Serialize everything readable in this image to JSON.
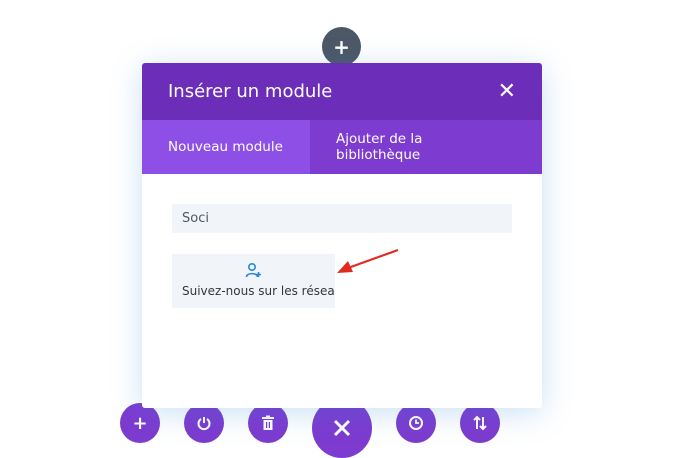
{
  "modal": {
    "title": "Insérer un module",
    "close_icon": "close-icon",
    "tabs": [
      {
        "label": "Nouveau module",
        "active": true
      },
      {
        "label_line1": "Ajouter de la",
        "label_line2": "bibliothèque",
        "active": false
      }
    ],
    "search": {
      "value": "Soci",
      "placeholder": ""
    },
    "modules": [
      {
        "label": "Suivez-nous sur les réseaux sociaux",
        "icon": "follow-user-icon"
      }
    ]
  },
  "bottom_toolbar": [
    {
      "icon": "plus-icon"
    },
    {
      "icon": "power-icon"
    },
    {
      "icon": "trash-icon"
    },
    {
      "icon": "close-icon"
    },
    {
      "icon": "history-icon"
    },
    {
      "icon": "sort-icon"
    }
  ],
  "colors": {
    "header": "#6c2eb9",
    "tabs_bar": "#7d3bcf",
    "tab_active": "#8e4fe6",
    "toolbar": "#7d3bcf",
    "top_add": "#4c5866",
    "annotation_arrow": "#e02b20"
  }
}
